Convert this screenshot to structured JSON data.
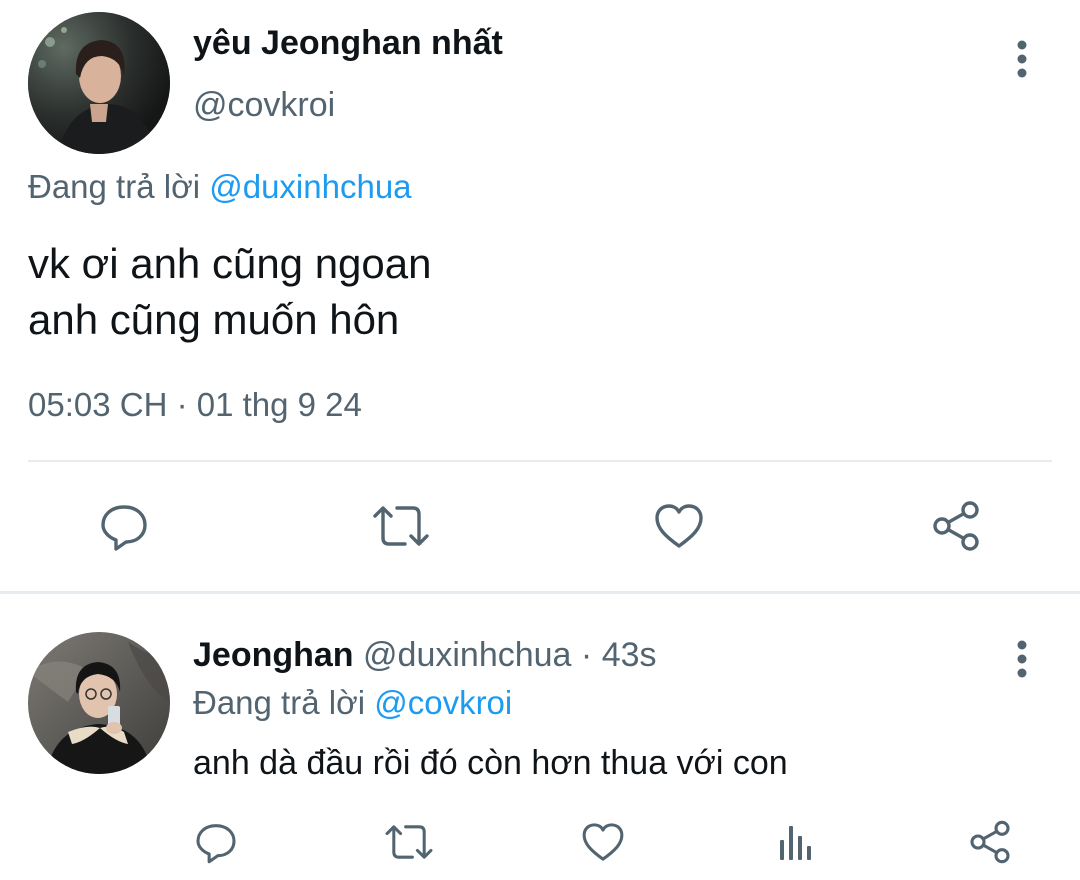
{
  "main_tweet": {
    "display_name": "yêu Jeonghan nhất",
    "handle": "@covkroi",
    "replying_prefix": "Đang trả lời",
    "replying_to": "@duxinhchua",
    "text_line1": "vk ơi anh cũng ngoan",
    "text_line2": "anh cũng muốn hôn",
    "timestamp": "05:03 CH · 01 thg 9 24"
  },
  "reply_tweet": {
    "display_name": "Jeonghan",
    "handle": "@duxinhchua",
    "meta_separator": " · ",
    "time_ago": "43s",
    "replying_prefix": "Đang trả lời",
    "replying_to": "@covkroi",
    "text": "anh dà đầu rồi đó còn hơn thua với con"
  },
  "icons": {
    "main_actions": [
      "reply-icon",
      "retweet-icon",
      "like-icon",
      "share-icon"
    ],
    "reply_actions": [
      "reply-icon",
      "retweet-icon",
      "like-icon",
      "analytics-icon",
      "share-icon"
    ],
    "more": "more-vertical-icon"
  },
  "colors": {
    "text_primary": "#0f1419",
    "text_secondary": "#536471",
    "mention": "#1d9bf0",
    "icon": "#536471",
    "divider": "#e6ecf0"
  }
}
